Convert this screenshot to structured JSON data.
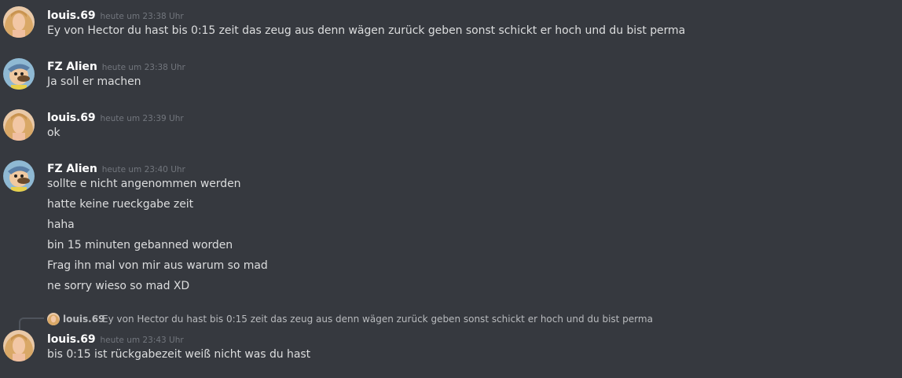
{
  "colors": {
    "background": "#36393f",
    "username": "#ffffff",
    "timestamp": "#72767d",
    "text": "#dcddde"
  },
  "messages": [
    {
      "user": "louis.69",
      "avatar": "blonde-woman-avatar",
      "time": "heute um 23:38 Uhr",
      "lines": [
        "Ey von Hector du hast bis 0:15 zeit das zeug aus denn wägen zurück geben sonst schickt er hoch und du bist perma"
      ]
    },
    {
      "user": "FZ Alien",
      "avatar": "cartoon-man-avatar",
      "time": "heute um 23:38 Uhr",
      "lines": [
        "Ja soll er machen"
      ]
    },
    {
      "user": "louis.69",
      "avatar": "blonde-woman-avatar",
      "time": "heute um 23:39 Uhr",
      "lines": [
        "ok"
      ]
    },
    {
      "user": "FZ Alien",
      "avatar": "cartoon-man-avatar",
      "time": "heute um 23:40 Uhr",
      "lines": [
        "sollte e nicht angenommen werden",
        "hatte keine rueckgabe zeit",
        "haha",
        "bin 15 minuten gebanned worden",
        "Frag ihn mal von mir aus warum so mad",
        "ne sorry wieso so mad XD"
      ]
    },
    {
      "user": "louis.69",
      "avatar": "blonde-woman-avatar",
      "time": "heute um 23:43 Uhr",
      "lines": [
        "bis 0:15 ist rückgabezeit weiß nicht was du hast"
      ],
      "reply": {
        "user": "louis.69",
        "text": "Ey von Hector du hast bis 0:15 zeit das zeug aus denn wägen zurück geben sonst schickt er hoch und du bist perma"
      }
    }
  ]
}
